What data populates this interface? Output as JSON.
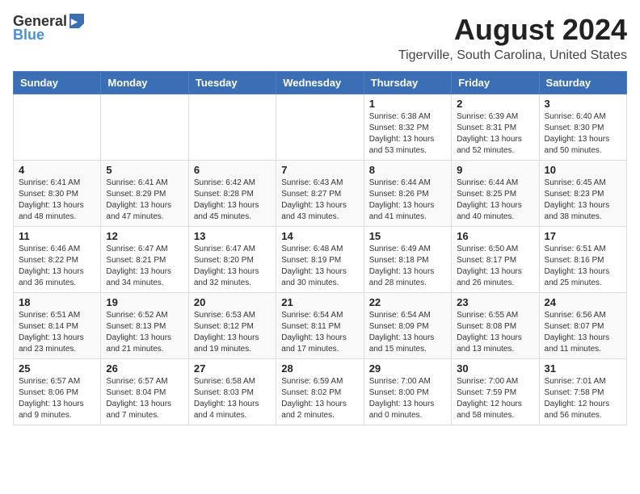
{
  "header": {
    "logo_general": "General",
    "logo_blue": "Blue",
    "month_year": "August 2024",
    "location": "Tigerville, South Carolina, United States"
  },
  "calendar": {
    "columns": [
      "Sunday",
      "Monday",
      "Tuesday",
      "Wednesday",
      "Thursday",
      "Friday",
      "Saturday"
    ],
    "weeks": [
      [
        {
          "day": "",
          "info": ""
        },
        {
          "day": "",
          "info": ""
        },
        {
          "day": "",
          "info": ""
        },
        {
          "day": "",
          "info": ""
        },
        {
          "day": "1",
          "info": "Sunrise: 6:38 AM\nSunset: 8:32 PM\nDaylight: 13 hours\nand 53 minutes."
        },
        {
          "day": "2",
          "info": "Sunrise: 6:39 AM\nSunset: 8:31 PM\nDaylight: 13 hours\nand 52 minutes."
        },
        {
          "day": "3",
          "info": "Sunrise: 6:40 AM\nSunset: 8:30 PM\nDaylight: 13 hours\nand 50 minutes."
        }
      ],
      [
        {
          "day": "4",
          "info": "Sunrise: 6:41 AM\nSunset: 8:30 PM\nDaylight: 13 hours\nand 48 minutes."
        },
        {
          "day": "5",
          "info": "Sunrise: 6:41 AM\nSunset: 8:29 PM\nDaylight: 13 hours\nand 47 minutes."
        },
        {
          "day": "6",
          "info": "Sunrise: 6:42 AM\nSunset: 8:28 PM\nDaylight: 13 hours\nand 45 minutes."
        },
        {
          "day": "7",
          "info": "Sunrise: 6:43 AM\nSunset: 8:27 PM\nDaylight: 13 hours\nand 43 minutes."
        },
        {
          "day": "8",
          "info": "Sunrise: 6:44 AM\nSunset: 8:26 PM\nDaylight: 13 hours\nand 41 minutes."
        },
        {
          "day": "9",
          "info": "Sunrise: 6:44 AM\nSunset: 8:25 PM\nDaylight: 13 hours\nand 40 minutes."
        },
        {
          "day": "10",
          "info": "Sunrise: 6:45 AM\nSunset: 8:23 PM\nDaylight: 13 hours\nand 38 minutes."
        }
      ],
      [
        {
          "day": "11",
          "info": "Sunrise: 6:46 AM\nSunset: 8:22 PM\nDaylight: 13 hours\nand 36 minutes."
        },
        {
          "day": "12",
          "info": "Sunrise: 6:47 AM\nSunset: 8:21 PM\nDaylight: 13 hours\nand 34 minutes."
        },
        {
          "day": "13",
          "info": "Sunrise: 6:47 AM\nSunset: 8:20 PM\nDaylight: 13 hours\nand 32 minutes."
        },
        {
          "day": "14",
          "info": "Sunrise: 6:48 AM\nSunset: 8:19 PM\nDaylight: 13 hours\nand 30 minutes."
        },
        {
          "day": "15",
          "info": "Sunrise: 6:49 AM\nSunset: 8:18 PM\nDaylight: 13 hours\nand 28 minutes."
        },
        {
          "day": "16",
          "info": "Sunrise: 6:50 AM\nSunset: 8:17 PM\nDaylight: 13 hours\nand 26 minutes."
        },
        {
          "day": "17",
          "info": "Sunrise: 6:51 AM\nSunset: 8:16 PM\nDaylight: 13 hours\nand 25 minutes."
        }
      ],
      [
        {
          "day": "18",
          "info": "Sunrise: 6:51 AM\nSunset: 8:14 PM\nDaylight: 13 hours\nand 23 minutes."
        },
        {
          "day": "19",
          "info": "Sunrise: 6:52 AM\nSunset: 8:13 PM\nDaylight: 13 hours\nand 21 minutes."
        },
        {
          "day": "20",
          "info": "Sunrise: 6:53 AM\nSunset: 8:12 PM\nDaylight: 13 hours\nand 19 minutes."
        },
        {
          "day": "21",
          "info": "Sunrise: 6:54 AM\nSunset: 8:11 PM\nDaylight: 13 hours\nand 17 minutes."
        },
        {
          "day": "22",
          "info": "Sunrise: 6:54 AM\nSunset: 8:09 PM\nDaylight: 13 hours\nand 15 minutes."
        },
        {
          "day": "23",
          "info": "Sunrise: 6:55 AM\nSunset: 8:08 PM\nDaylight: 13 hours\nand 13 minutes."
        },
        {
          "day": "24",
          "info": "Sunrise: 6:56 AM\nSunset: 8:07 PM\nDaylight: 13 hours\nand 11 minutes."
        }
      ],
      [
        {
          "day": "25",
          "info": "Sunrise: 6:57 AM\nSunset: 8:06 PM\nDaylight: 13 hours\nand 9 minutes."
        },
        {
          "day": "26",
          "info": "Sunrise: 6:57 AM\nSunset: 8:04 PM\nDaylight: 13 hours\nand 7 minutes."
        },
        {
          "day": "27",
          "info": "Sunrise: 6:58 AM\nSunset: 8:03 PM\nDaylight: 13 hours\nand 4 minutes."
        },
        {
          "day": "28",
          "info": "Sunrise: 6:59 AM\nSunset: 8:02 PM\nDaylight: 13 hours\nand 2 minutes."
        },
        {
          "day": "29",
          "info": "Sunrise: 7:00 AM\nSunset: 8:00 PM\nDaylight: 13 hours\nand 0 minutes."
        },
        {
          "day": "30",
          "info": "Sunrise: 7:00 AM\nSunset: 7:59 PM\nDaylight: 12 hours\nand 58 minutes."
        },
        {
          "day": "31",
          "info": "Sunrise: 7:01 AM\nSunset: 7:58 PM\nDaylight: 12 hours\nand 56 minutes."
        }
      ]
    ]
  }
}
